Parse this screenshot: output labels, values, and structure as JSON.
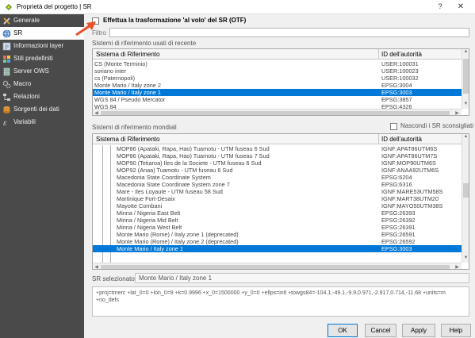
{
  "window": {
    "title": "Proprietà del progetto | SR",
    "help_glyph": "?",
    "close_glyph": "✕"
  },
  "sidebar": {
    "items": [
      {
        "label": "Generale",
        "icon": "wrench-screwdriver-icon"
      },
      {
        "label": "SR",
        "icon": "globe-icon",
        "selected": true
      },
      {
        "label": "Informazioni layer",
        "icon": "layer-info-icon"
      },
      {
        "label": "Stili predefiniti",
        "icon": "styles-icon"
      },
      {
        "label": "Server OWS",
        "icon": "server-icon"
      },
      {
        "label": "Macro",
        "icon": "gears-icon"
      },
      {
        "label": "Relazioni",
        "icon": "relations-icon"
      },
      {
        "label": "Sorgenti dei dati",
        "icon": "data-source-icon"
      },
      {
        "label": "Variabili",
        "icon": "variables-icon"
      }
    ]
  },
  "otf": {
    "label": "Effettua la trasformazione 'al volo' del SR (OTF)",
    "checked": false
  },
  "filter": {
    "label": "Filtro",
    "value": ""
  },
  "recent": {
    "section_label": "Sistemi di riferimento usati di recente",
    "columns": [
      "Sistema di Riferimento",
      "ID dell'autorità"
    ],
    "rows": [
      {
        "name": "CS (Monte Terminio)",
        "id": "USER:100031"
      },
      {
        "name": "soriano inter",
        "id": "USER:100023"
      },
      {
        "name": "cs (Paternopoli)",
        "id": "USER:100032"
      },
      {
        "name": "Monte Mario / Italy zone 2",
        "id": "EPSG:3004"
      },
      {
        "name": "Monte Mario / Italy zone 1",
        "id": "EPSG:3003",
        "selected": true
      },
      {
        "name": "WGS 84 / Pseudo Mercator",
        "id": "EPSG:3857"
      },
      {
        "name": "WGS 84",
        "id": "EPSG:4326"
      }
    ]
  },
  "world": {
    "section_label": "Sistemi di riferimento mondiali",
    "hide_deprecated_label": "Nascondi i SR sconsigliati",
    "columns": [
      "Sistema di Riferimento",
      "ID dell'autorità"
    ],
    "rows": [
      {
        "name": "MOP86 (Apataki, Rapa, Hao) Tuamotu - UTM fuseau 6 Sud",
        "id": "IGNF:APAT86UTM6S"
      },
      {
        "name": "MOP86 (Apataki, Rapa, Hao) Tuamotu - UTM fuseau 7 Sud",
        "id": "IGNF:APAT86UTM7S"
      },
      {
        "name": "MOP90 (Tetiaroa) Iles de la Societe - UTM fuseau 6 Sud",
        "id": "IGNF:MOP90UTM6S"
      },
      {
        "name": "MOP92 (Anaa) Tuamotu - UTM fuseau 6 Sud",
        "id": "IGNF:ANAA92UTM6S"
      },
      {
        "name": "Macedonia State Coordinate System",
        "id": "EPSG:6204"
      },
      {
        "name": "Macedonia State Coordinate System zone 7",
        "id": "EPSG:6316"
      },
      {
        "name": "Mare - Iles Loyaute - UTM fuseau 58 Sud",
        "id": "IGNF:MARE53UTM58S"
      },
      {
        "name": "Martinique Fort-Desaix",
        "id": "IGNF:MART38UTM20"
      },
      {
        "name": "Mayotte Combani",
        "id": "IGNF:MAYO50UTM38S"
      },
      {
        "name": "Minna / Nigeria East Belt",
        "id": "EPSG:26393"
      },
      {
        "name": "Minna / Nigeria Mid Belt",
        "id": "EPSG:26392"
      },
      {
        "name": "Minna / Nigeria West Belt",
        "id": "EPSG:26391"
      },
      {
        "name": "Monte Mario (Rome) / Italy zone 1 (deprecated)",
        "id": "EPSG:26591"
      },
      {
        "name": "Monte Mario (Rome) / Italy zone 2 (deprecated)",
        "id": "EPSG:26592"
      },
      {
        "name": "Monte Mario / Italy zone 1",
        "id": "EPSG:3003",
        "selected": true
      }
    ]
  },
  "selected_crs": {
    "label": "SR selezionato:",
    "value": "Monte Mario / Italy zone 1",
    "proj_definition": "+proj=tmerc +lat_0=0 +lon_0=9 +k=0.9996 +x_0=1500000 +y_0=0 +ellps=intl +towgs84=-104.1,-49.1,-9.9,0.971,-2.917,0.714,-11.68 +units=m +no_defs"
  },
  "buttons": {
    "ok": "OK",
    "cancel": "Cancel",
    "apply": "Apply",
    "help": "Help"
  },
  "colors": {
    "sidebar_bg": "#4a4a4a",
    "selection": "#0078d7",
    "annotation_arrow": "#e8522a"
  }
}
